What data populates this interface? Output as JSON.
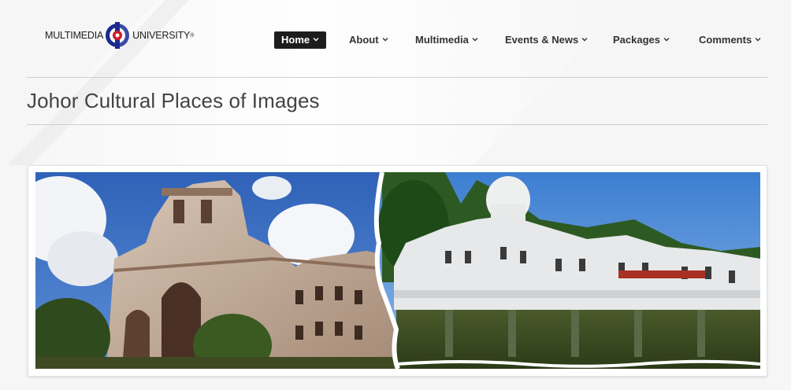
{
  "logo": {
    "left_text": "MULTIMEDIA",
    "right_text": "UNIVERSITY",
    "registered_mark": "®",
    "colors": {
      "blue": "#1a2a8f",
      "red": "#d01c24"
    }
  },
  "nav": {
    "items": [
      {
        "label": "Home",
        "active": true
      },
      {
        "label": "About",
        "active": false
      },
      {
        "label": "Multimedia",
        "active": false
      },
      {
        "label": "Events & News",
        "active": false
      },
      {
        "label": "Packages",
        "active": false
      },
      {
        "label": "Comments",
        "active": false
      }
    ]
  },
  "page": {
    "title": "Johor Cultural Places of Images"
  },
  "banner": {
    "left_image": "colonial-building-photo",
    "right_image": "white-palace-photo"
  }
}
